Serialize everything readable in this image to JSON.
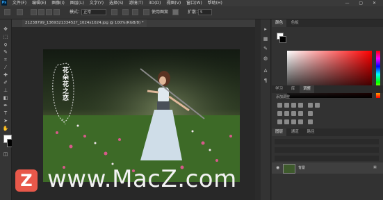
{
  "menubar": {
    "logo": "Ps",
    "items": [
      "文件(F)",
      "编辑(E)",
      "图像(I)",
      "图层(L)",
      "文字(Y)",
      "选择(S)",
      "滤镜(T)",
      "3D(D)",
      "视图(V)",
      "窗口(W)",
      "帮助(H)"
    ],
    "window_controls": "— ▢ ✕"
  },
  "options": {
    "feather_label": "模式：",
    "mode_value": "正常",
    "use_pressure_label": "使用图案",
    "spread_label": "扩散：",
    "spread_value": "5"
  },
  "document": {
    "tab_title": "21238799_136932133452?_1024x1024.jpg @ 100%(RGB/8) *"
  },
  "canvas": {
    "overlay_text": "花朵花之恋"
  },
  "panels": {
    "color_tabs": [
      "颜色",
      "色板"
    ],
    "adjust_tabs": [
      "学习",
      "库",
      "调整"
    ],
    "adjust_title": "添加调整",
    "layer_tabs": [
      "图层",
      "通道",
      "路径"
    ],
    "layer_name": "背景",
    "colors": {
      "accent": "#e8584a",
      "bg": "#323232"
    }
  },
  "watermark": {
    "logo_letter": "Z",
    "text": "www.MacZ.com"
  }
}
